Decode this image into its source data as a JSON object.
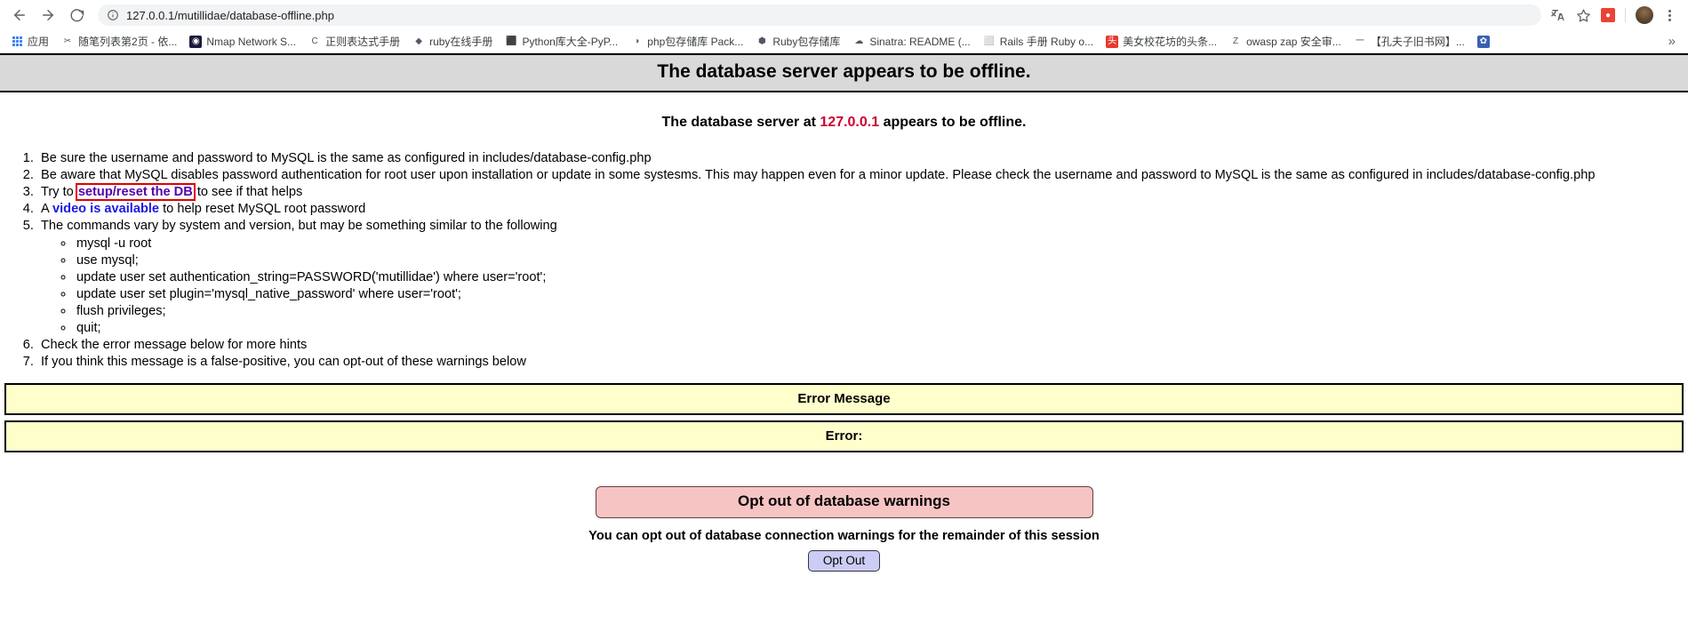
{
  "browser": {
    "back_icon": "back-arrow-icon",
    "forward_icon": "forward-arrow-icon",
    "reload_icon": "reload-icon",
    "site_info_icon": "info-circle-icon",
    "url": "127.0.0.1/mutillidae/database-offline.php",
    "translate_icon": "translate-icon",
    "bookmark_star_icon": "star-icon",
    "extension_icon": "extension-icon",
    "profile_avatar": "avatar",
    "menu_icon": "kebab-menu-icon",
    "bookmarks_overflow": "»",
    "bookmarks": [
      {
        "label": "应用",
        "icon": "apps-grid-icon",
        "glyph": "",
        "bg": ""
      },
      {
        "label": "随笔列表第2页 - 依...",
        "icon": "pen-icon",
        "glyph": "✂",
        "bg": "#ffffff"
      },
      {
        "label": "Nmap Network S...",
        "icon": "nmap-eye-icon",
        "glyph": "◉",
        "bg": "#1b1b3a"
      },
      {
        "label": "正则表达式手册",
        "icon": "c-logo-icon",
        "glyph": "C",
        "bg": "#ffffff"
      },
      {
        "label": "ruby在线手册",
        "icon": "ruby-gem-icon",
        "glyph": "◆",
        "bg": "#ffffff"
      },
      {
        "label": "Python库大全-PyP...",
        "icon": "package-box-icon",
        "glyph": "⬛",
        "bg": "#ffffff"
      },
      {
        "label": "php包存储库 Pack...",
        "icon": "php-elephant-icon",
        "glyph": "◑",
        "bg": "#ffffff"
      },
      {
        "label": "Ruby包存储库",
        "icon": "rubygems-icon",
        "glyph": "⬢",
        "bg": "#ffffff"
      },
      {
        "label": "Sinatra: README (...",
        "icon": "sinatra-hat-icon",
        "glyph": "☁",
        "bg": "#ffffff"
      },
      {
        "label": "Rails 手册 Ruby o...",
        "icon": "document-icon",
        "glyph": "⬜",
        "bg": "#ffffff"
      },
      {
        "label": "美女校花坊的头条...",
        "icon": "toutiao-icon",
        "glyph": "头",
        "bg": "#e8392f"
      },
      {
        "label": "owasp zap 安全审...",
        "icon": "zap-icon",
        "glyph": "Z",
        "bg": "#ffffff"
      },
      {
        "label": "【孔夫子旧书网】...",
        "icon": "kongfz-icon",
        "glyph": "一",
        "bg": "#ffffff"
      },
      {
        "label": "",
        "icon": "paw-icon",
        "glyph": "✿",
        "bg": "#3b5fb5"
      }
    ]
  },
  "page": {
    "title": "The database server appears to be offline.",
    "subtitle_prefix": "The database server at ",
    "subtitle_ip": "127.0.0.1",
    "subtitle_suffix": " appears to be offline.",
    "hints": [
      {
        "id": "hint-credentials",
        "text": "Be sure the username and password to MySQL is the same as configured in includes/database-config.php"
      },
      {
        "id": "hint-auth-disabled",
        "text": "Be aware that MySQL disables password authentication for root user upon installation or update in some systesms. This may happen even for a minor update. Please check the username and password to MySQL is the same as configured in includes/database-config.php"
      },
      {
        "id": "hint-setup-reset",
        "prefix": "Try to ",
        "link_label": "setup/reset the DB",
        "suffix": " to see if that helps"
      },
      {
        "id": "hint-video",
        "prefix": "A ",
        "link_label": "video is available",
        "suffix": " to help reset MySQL root password"
      },
      {
        "id": "hint-commands",
        "text": "The commands vary by system and version, but may be something similar to the following",
        "sub_items": [
          "mysql -u root",
          "use mysql;",
          "update user set authentication_string=PASSWORD('mutillidae') where user='root';",
          "update user set plugin='mysql_native_password' where user='root';",
          "flush privileges;",
          "quit;"
        ]
      },
      {
        "id": "hint-error-below",
        "text": "Check the error message below for more hints"
      },
      {
        "id": "hint-false-positive",
        "text": "If you think this message is a false-positive, you can opt-out of these warnings below"
      }
    ],
    "error_message_header": "Error Message",
    "error_message_body": "Error:",
    "optout_banner": "Opt out of database warnings",
    "optout_description": "You can opt out of database connection warnings for the remainder of this session",
    "optout_button": "Opt Out"
  },
  "colors": {
    "title_bar_bg": "#d9d9d9",
    "ip_red": "#cc0033",
    "error_box_bg": "#ffffcc",
    "optout_banner_bg": "#f7c4c4",
    "optout_button_bg": "#ccccf4",
    "link_purple": "#5500aa",
    "link_blue": "#1a1ae6",
    "focus_outline_red": "#dd0000"
  }
}
